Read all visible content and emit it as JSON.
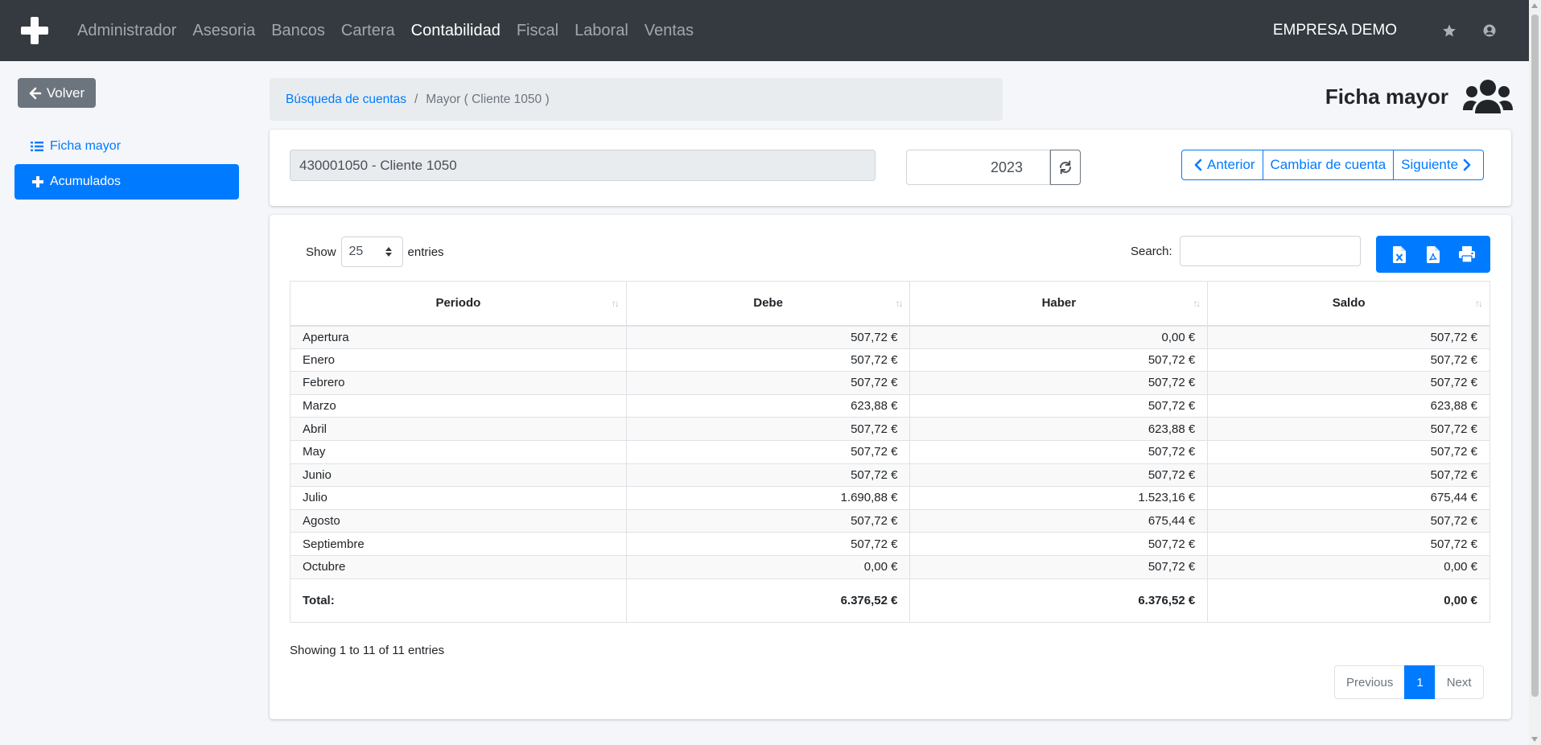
{
  "navbar": {
    "brand_icon": "plus-icon",
    "links": [
      "Administrador",
      "Asesoria",
      "Bancos",
      "Cartera",
      "Contabilidad",
      "Fiscal",
      "Laboral",
      "Ventas"
    ],
    "active_link": "Contabilidad",
    "company": "EMPRESA DEMO",
    "icons": [
      "star-icon",
      "user-circle-icon"
    ]
  },
  "sidebar": {
    "back_label": "Volver",
    "items": [
      {
        "label": "Ficha mayor",
        "icon": "list-icon",
        "active": false
      },
      {
        "label": "Acumulados",
        "icon": "plus-icon",
        "active": true
      }
    ]
  },
  "breadcrumb": {
    "link": "Búsqueda de cuentas",
    "separator": "/",
    "current": "Mayor ( Cliente 1050 )"
  },
  "page": {
    "title": "Ficha mayor",
    "icon": "users-icon"
  },
  "filters": {
    "account_value": "430001050 - Cliente 1050",
    "year_value": "2023",
    "prev_label": "Anterior",
    "change_label": "Cambiar de cuenta",
    "next_label": "Siguiente"
  },
  "table_controls": {
    "show_label": "Show",
    "length_value": "25",
    "entries_label": "entries",
    "search_label": "Search:",
    "export_icons": [
      "file-excel-icon",
      "file-pdf-icon",
      "print-icon"
    ]
  },
  "table": {
    "columns": [
      "Periodo",
      "Debe",
      "Haber",
      "Saldo"
    ],
    "rows": [
      [
        "Apertura",
        "507,72 €",
        "0,00 €",
        "507,72 €"
      ],
      [
        "Enero",
        "507,72 €",
        "507,72 €",
        "507,72 €"
      ],
      [
        "Febrero",
        "507,72 €",
        "507,72 €",
        "507,72 €"
      ],
      [
        "Marzo",
        "623,88 €",
        "507,72 €",
        "623,88 €"
      ],
      [
        "Abril",
        "507,72 €",
        "623,88 €",
        "507,72 €"
      ],
      [
        "May",
        "507,72 €",
        "507,72 €",
        "507,72 €"
      ],
      [
        "Junio",
        "507,72 €",
        "507,72 €",
        "507,72 €"
      ],
      [
        "Julio",
        "1.690,88 €",
        "1.523,16 €",
        "675,44 €"
      ],
      [
        "Agosto",
        "507,72 €",
        "675,44 €",
        "507,72 €"
      ],
      [
        "Septiembre",
        "507,72 €",
        "507,72 €",
        "507,72 €"
      ],
      [
        "Octubre",
        "0,00 €",
        "507,72 €",
        "0,00 €"
      ]
    ],
    "footer": [
      "Total:",
      "6.376,52 €",
      "6.376,52 €",
      "0,00 €"
    ]
  },
  "info": "Showing 1 to 11 of 11 entries",
  "pagination": {
    "previous": "Previous",
    "current_page": "1",
    "next": "Next"
  },
  "colors": {
    "primary": "#007bff",
    "navbar": "#343a40",
    "secondary": "#6c757d"
  }
}
